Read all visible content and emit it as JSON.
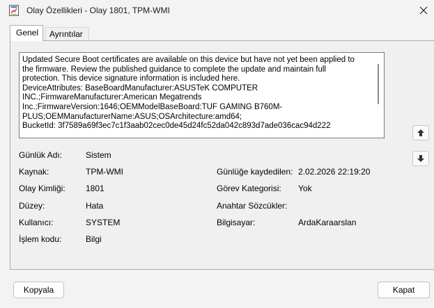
{
  "window": {
    "title": "Olay Özellikleri - Olay 1801, TPM-WMI"
  },
  "tabs": [
    {
      "label": "Genel",
      "active": true
    },
    {
      "label": "Ayrıntılar",
      "active": false
    }
  ],
  "description": "Updated Secure Boot certificates are available on this device but have not yet been applied to\nthe firmware. Review the published guidance to complete the update and maintain full\nprotection. This device signature information is included here.\nDeviceAttributes: BaseBoardManufacturer:ASUSTeK COMPUTER\nINC.;FirmwareManufacturer:American Megatrends\nInc.;FirmwareVersion:1646;OEMModelBaseBoard:TUF GAMING B760M-\nPLUS;OEMManufacturerName:ASUS;OSArchitecture:amd64;\nBucketId: 3f7589a69f3ec7c1f3aab02cec0de45d24fc52da042c893d7ade036cac94d222",
  "fields": {
    "log_name": {
      "label": "Günlük Adı:",
      "value": "Sistem"
    },
    "source": {
      "label": "Kaynak:",
      "value": "TPM-WMI"
    },
    "logged": {
      "label": "Günlüğe kaydedilen:",
      "value": "2.02.2026 22:19:20"
    },
    "event_id": {
      "label": "Olay Kimliği:",
      "value": "1801"
    },
    "task_category": {
      "label": "Görev Kategorisi:",
      "value": "Yok"
    },
    "level": {
      "label": "Düzey:",
      "value": "Hata"
    },
    "keywords": {
      "label": "Anahtar Sözcükler:",
      "value": ""
    },
    "user": {
      "label": "Kullanıcı:",
      "value": "SYSTEM"
    },
    "computer": {
      "label": "Bilgisayar:",
      "value": "ArdaKaraarslan"
    },
    "opcode": {
      "label": "İşlem kodu:",
      "value": "Bilgi"
    }
  },
  "buttons": {
    "copy": "Kopyala",
    "close": "Kapat"
  },
  "icons": {
    "app": "event-log-icon",
    "close": "close-icon",
    "up": "arrow-up-icon",
    "down": "arrow-down-icon"
  }
}
